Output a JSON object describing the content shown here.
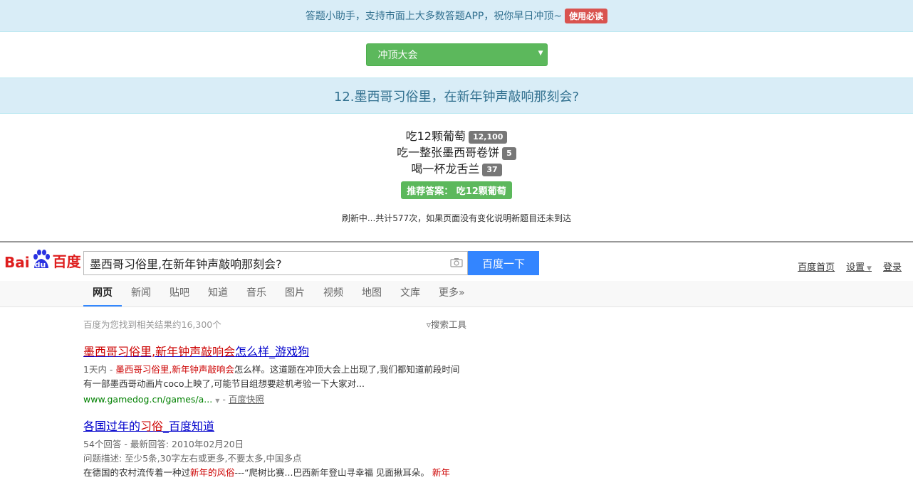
{
  "topbar": {
    "text": "答题小助手，支持市面上大多数答题APP，祝你早日冲顶~",
    "badge": "使用必读"
  },
  "selector": {
    "value": "冲顶大会",
    "caret": "▼"
  },
  "question": "12.墨西哥习俗里，在新年钟声敲响那刻会?",
  "answers": [
    {
      "text": "吃12颗葡萄",
      "count": "12,100"
    },
    {
      "text": "吃一整张墨西哥卷饼",
      "count": "5"
    },
    {
      "text": "喝一杯龙舌兰",
      "count": "37"
    }
  ],
  "recommend": "推荐答案： 吃12颗葡萄",
  "refresh": "刷新中...共计577次，如果页面没有变化说明新题目还未到达",
  "baidu": {
    "logo_left": "Bai",
    "logo_du": "du",
    "logo_right": "百度",
    "query": "墨西哥习俗里,在新年钟声敲响那刻会?",
    "search_button": "百度一下",
    "links": [
      "百度首页",
      "设置",
      "登录"
    ],
    "tabs": [
      "网页",
      "新闻",
      "贴吧",
      "知道",
      "音乐",
      "图片",
      "视频",
      "地图",
      "文库",
      "更多»"
    ],
    "result_count": "百度为您找到相关结果约16,300个",
    "search_tool": "搜索工具",
    "results": [
      {
        "title_a": "墨西哥习俗里,新年钟声敲响会",
        "title_b": "怎么样_游戏狗",
        "desc_prefix": "1天内 - ",
        "desc_em": "墨西哥习俗里,新年钟声敲响会",
        "desc_rest": "怎么样。这道题在冲顶大会上出现了,我们都知道前段时间有一部墨西哥动画片coco上映了,可能节目组想要趁机考验一下大家对...",
        "url": "www.gamedog.cn/games/a...",
        "snapshot": "百度快照"
      },
      {
        "title_a": "各国过年的",
        "title_em": "习俗",
        "title_b": "_百度知道",
        "meta": "54个回答 - 最新回答: 2010年02月20日",
        "desc1": "问题描述: 至少5条,30字左右或更多,不要太多,中国多点",
        "desc2_a": "在德国的农村流传着一种过",
        "desc2_em": "新年的风俗",
        "desc2_b": "---“爬树比赛...巴西新年登山寻幸福 见面揪耳朵。",
        "desc2_em2": "新年"
      }
    ]
  }
}
